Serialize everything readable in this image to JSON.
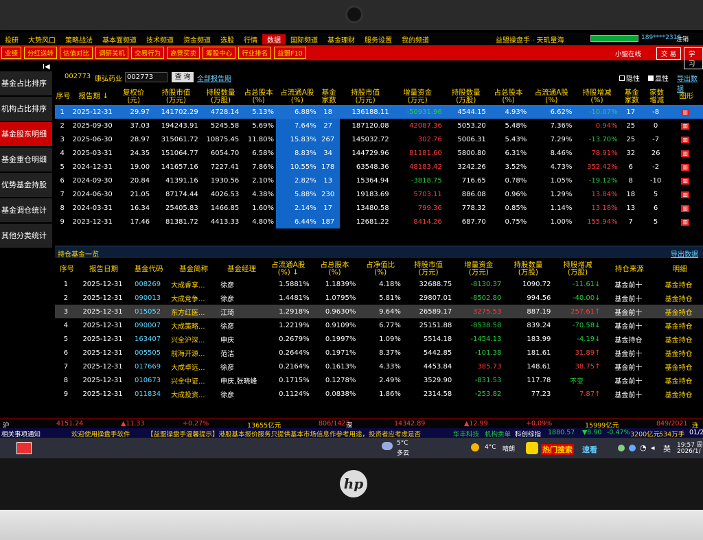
{
  "menu": [
    "投研",
    "大势风口",
    "策略战法",
    "基本面频道",
    "技术频道",
    "资金频道",
    "选股",
    "行情",
    "数据",
    "国际频道",
    "基金理财",
    "服务设置",
    "我的频道"
  ],
  "menu_active": "数据",
  "brand": "益盟操盘手 · 天玑量海",
  "user_info": "189****2316",
  "logout": "注销",
  "toolbar": [
    "业绩",
    "分红送转",
    "估值对比",
    "调研关机",
    "交易行为",
    "高管买卖",
    "筹股中心",
    "行业排名",
    "益盟F10"
  ],
  "online": "小盟在线",
  "btn_trade": "交 易",
  "btn_learn": "学习",
  "sidebar": [
    "基金占比排序",
    "机构占比排序",
    "基金股东明细",
    "基金重仓明细",
    "优势基金持股",
    "基金调仓统计",
    "其他分类统计"
  ],
  "sidebar_active": 2,
  "collapse": "I◀",
  "search": {
    "code": "002773",
    "name": "康弘药业",
    "input": "002773",
    "query": "查 询",
    "report": "全部报告期",
    "opt1": "隐性",
    "opt2": "显性",
    "export": "导出数据"
  },
  "table1": {
    "headers": [
      "序号",
      "报告期 ↓",
      "复权价\n(元)",
      "持股市值\n(万元)",
      "持股数量\n(万股)",
      "占总股本\n(%)",
      "占流通A股\n(%)",
      "基金\n家数",
      "持股市值\n(万元)",
      "增量资金\n(万元)",
      "持股数量\n(万股)",
      "占总股本\n(%)",
      "占流通A股\n(%)",
      "持股增减\n(%)",
      "基金\n家数",
      "家数\n增减",
      "图形"
    ],
    "rows": [
      [
        "1",
        "2025-12-31",
        "29.97",
        "141702.29",
        "4728.14",
        "5.13%",
        "6.88%",
        "18",
        "136188.11",
        "-50931.96",
        "4544.15",
        "4.93%",
        "6.62%",
        "-10.07%",
        "17",
        "-8"
      ],
      [
        "2",
        "2025-09-30",
        "37.03",
        "194243.91",
        "5245.58",
        "5.69%",
        "7.64%",
        "27",
        "187120.08",
        "42087.36",
        "5053.20",
        "5.48%",
        "7.36%",
        "0.94%",
        "25",
        "0"
      ],
      [
        "3",
        "2025-06-30",
        "28.97",
        "315061.72",
        "10875.45",
        "11.80%",
        "15.83%",
        "267",
        "145032.72",
        "302.76",
        "5006.31",
        "5.43%",
        "7.29%",
        "-13.70%",
        "25",
        "-7"
      ],
      [
        "4",
        "2025-03-31",
        "24.35",
        "151064.77",
        "6054.70",
        "6.58%",
        "8.83%",
        "34",
        "144729.96",
        "81181.60",
        "5800.80",
        "6.31%",
        "8.46%",
        "78.91%",
        "32",
        "26"
      ],
      [
        "5",
        "2024-12-31",
        "19.00",
        "141657.16",
        "7227.41",
        "7.86%",
        "10.55%",
        "178",
        "63548.36",
        "48183.42",
        "3242.26",
        "3.52%",
        "4.73%",
        "352.42%",
        "6",
        "-2"
      ],
      [
        "6",
        "2024-09-30",
        "20.84",
        "41391.16",
        "1930.56",
        "2.10%",
        "2.82%",
        "13",
        "15364.94",
        "-3818.75",
        "716.65",
        "0.78%",
        "1.05%",
        "-19.12%",
        "8",
        "-10"
      ],
      [
        "7",
        "2024-06-30",
        "21.05",
        "87174.44",
        "4026.53",
        "4.38%",
        "5.88%",
        "230",
        "19183.69",
        "5703.11",
        "886.08",
        "0.96%",
        "1.29%",
        "13.84%",
        "18",
        "5"
      ],
      [
        "8",
        "2024-03-31",
        "16.34",
        "25405.83",
        "1466.85",
        "1.60%",
        "2.14%",
        "17",
        "13480.58",
        "799.36",
        "778.32",
        "0.85%",
        "1.14%",
        "13.18%",
        "13",
        "6"
      ],
      [
        "9",
        "2023-12-31",
        "17.46",
        "81381.72",
        "4413.33",
        "4.80%",
        "6.44%",
        "187",
        "12681.22",
        "8414.26",
        "687.70",
        "0.75%",
        "1.00%",
        "155.94%",
        "7",
        "5"
      ]
    ]
  },
  "section2_title": "持仓基金一览",
  "section2_export": "导出数据",
  "table2": {
    "headers": [
      "序号",
      "报告日期",
      "基金代码",
      "基金简称",
      "基金经理",
      "占流通A股\n(%) ↓",
      "占总股本\n(%)",
      "占净值比\n(%)",
      "持股市值\n(万元)",
      "增量资金\n(万元)",
      "持股数量\n(万股)",
      "持股增减\n(万股)",
      "持仓来源",
      "明细"
    ],
    "rows": [
      [
        "1",
        "2025-12-31",
        "008269",
        "大成睿享...",
        "徐彦",
        "1.5881%",
        "1.1839%",
        "4.18%",
        "32688.75",
        "-8130.37",
        "1090.72",
        "-11.61↓",
        "基金前十",
        "基金持仓"
      ],
      [
        "2",
        "2025-12-31",
        "090013",
        "大成竞争...",
        "徐彦",
        "1.4481%",
        "1.0795%",
        "5.81%",
        "29807.01",
        "-8502.80",
        "994.56",
        "-40.00↓",
        "基金前十",
        "基金持仓"
      ],
      [
        "3",
        "2025-12-31",
        "015052",
        "东方红医...",
        "江琦",
        "1.2918%",
        "0.9630%",
        "9.64%",
        "26589.17",
        "3275.53",
        "887.19",
        "257.61↑",
        "基金前十",
        "基金持仓"
      ],
      [
        "4",
        "2025-12-31",
        "090007",
        "大成策略...",
        "徐彦",
        "1.2219%",
        "0.9109%",
        "6.77%",
        "25151.88",
        "-8538.58",
        "839.24",
        "-70.58↓",
        "基金前十",
        "基金持仓"
      ],
      [
        "5",
        "2025-12-31",
        "163407",
        "兴全沪深...",
        "申庆",
        "0.2679%",
        "0.1997%",
        "1.09%",
        "5514.18",
        "-1454.13",
        "183.99",
        "-4.19↓",
        "基金持仓",
        "基金持仓"
      ],
      [
        "6",
        "2025-12-31",
        "005505",
        "前海开源...",
        "范洁",
        "0.2644%",
        "0.1971%",
        "8.37%",
        "5442.85",
        "-101.38",
        "181.61",
        "31.89↑",
        "基金前十",
        "基金持仓"
      ],
      [
        "7",
        "2025-12-31",
        "017669",
        "大成卓远...",
        "徐彦",
        "0.2164%",
        "0.1613%",
        "4.33%",
        "4453.84",
        "385.73",
        "148.61",
        "38.75↑",
        "基金前十",
        "基金持仓"
      ],
      [
        "8",
        "2025-12-31",
        "010673",
        "兴全中证...",
        "申庆,张晓峰",
        "0.1715%",
        "0.1278%",
        "2.49%",
        "3529.90",
        "-831.53",
        "117.78",
        "不变",
        "基金前十",
        "基金持仓"
      ],
      [
        "9",
        "2025-12-31",
        "011834",
        "大成投资...",
        "徐彦",
        "0.1124%",
        "0.0838%",
        "1.86%",
        "2314.58",
        "-253.82",
        "77.23",
        "7.87↑",
        "基金前十",
        "基金持仓"
      ]
    ]
  },
  "ticker": {
    "sh_label": "沪",
    "sh_val": "4151.24",
    "sh_chg": "▲11.33",
    "sh_pct": "+0.27%",
    "sh_amt": "13655亿元",
    "sh_ud": "806/1423",
    "sz_label": "深",
    "sz_val": "14342.89",
    "sz_chg": "▲12.99",
    "sz_pct": "+0.09%",
    "sz_amt": "15999亿元",
    "sz_ud": "849/2021",
    "tail": "连"
  },
  "news": {
    "a": "相关事项通知",
    "b": "欢迎使用操盘手软件",
    "c": "【益盟操盘手温馨提示】港股基本报价服务只提供基本市场信息作参考用途，投资者应考虑是否",
    "d": "华丰科技",
    "e": "机构卖单",
    "f": "科创综指",
    "g": "1880.57",
    "h": "▼8.90",
    "i": "-0.47%",
    "j": "3200亿元",
    "k": "534万手",
    "l": "01/2"
  },
  "taskbar": {
    "temp1": "5°C",
    "cond1": "多云",
    "temp2": "4°C",
    "cond2": "晴朗",
    "hot": "热门搜索",
    "hot2": "速看",
    "lang": "英",
    "time": "19:57 周",
    "date": "2026/1/"
  },
  "logo": "hp"
}
